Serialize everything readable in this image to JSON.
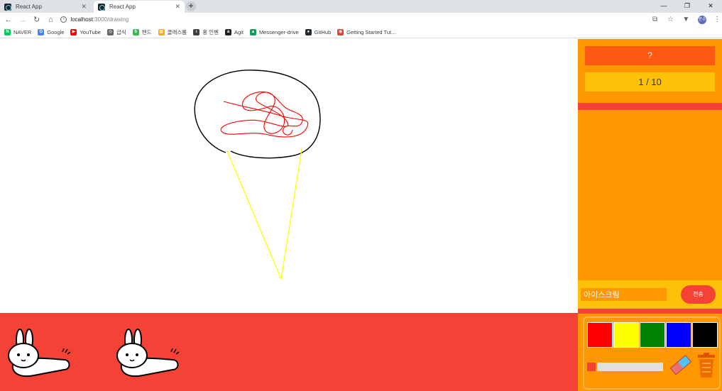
{
  "browser": {
    "tabs": [
      {
        "title": "React App",
        "close": "✕",
        "active": false
      },
      {
        "title": "React App",
        "close": "✕",
        "active": true
      }
    ],
    "new_tab": "+",
    "window_controls": {
      "minimize": "—",
      "restore": "❐",
      "close": "✕"
    },
    "nav": {
      "back": "←",
      "forward": "→",
      "reload": "↻",
      "home": "⌂"
    },
    "address": {
      "host": "localhost",
      "path": ":3000/drawing"
    },
    "toolbar_icons": [
      "translate-icon",
      "star-icon",
      "extension-icon",
      "profile-icon",
      "menu-icon"
    ],
    "profile_initials": "분수",
    "bookmarks": [
      {
        "label": "NAVER",
        "icon": "naver-icon",
        "color": "#03c75a",
        "glyph": "N"
      },
      {
        "label": "Google",
        "icon": "google-icon",
        "color": "#4285f4",
        "glyph": "G"
      },
      {
        "label": "YouTube",
        "icon": "youtube-icon",
        "color": "#ff0000",
        "glyph": "▶"
      },
      {
        "label": "급식",
        "icon": "globe-icon",
        "color": "#5f6368",
        "glyph": "◎"
      },
      {
        "label": "밴드",
        "icon": "band-icon",
        "color": "#2cc04c",
        "glyph": "b"
      },
      {
        "label": "클래스룸",
        "icon": "classroom-icon",
        "color": "#f9ab00",
        "glyph": "▦"
      },
      {
        "label": "홍 인벤",
        "icon": "inven-icon",
        "color": "#3c4043",
        "glyph": "ı"
      },
      {
        "label": "Agit",
        "icon": "agit-icon",
        "color": "#202124",
        "glyph": "a"
      },
      {
        "label": "Messenger-drive",
        "icon": "drive-icon",
        "color": "#0f9d58",
        "glyph": "▲"
      },
      {
        "label": "GitHub",
        "icon": "github-icon",
        "color": "#24292e",
        "glyph": "●"
      },
      {
        "label": "Getting Started Tut...",
        "icon": "chrome-icon",
        "color": "#db4437",
        "glyph": "◉"
      }
    ]
  },
  "game": {
    "word": "?",
    "round": "1 / 10",
    "answer_value": "아이스크림",
    "send_label": "전송",
    "palette": [
      {
        "name": "red",
        "color": "#ff0000"
      },
      {
        "name": "yellow",
        "color": "#ffff00"
      },
      {
        "name": "green",
        "color": "#008000"
      },
      {
        "name": "blue",
        "color": "#0000ff"
      },
      {
        "name": "black",
        "color": "#000000"
      }
    ],
    "players": [
      "bunny",
      "bunny"
    ],
    "colors": {
      "panel": "#ff9800",
      "word_box": "#ff5a14",
      "round_box": "#ffc107",
      "accent_red": "#f44336"
    }
  }
}
